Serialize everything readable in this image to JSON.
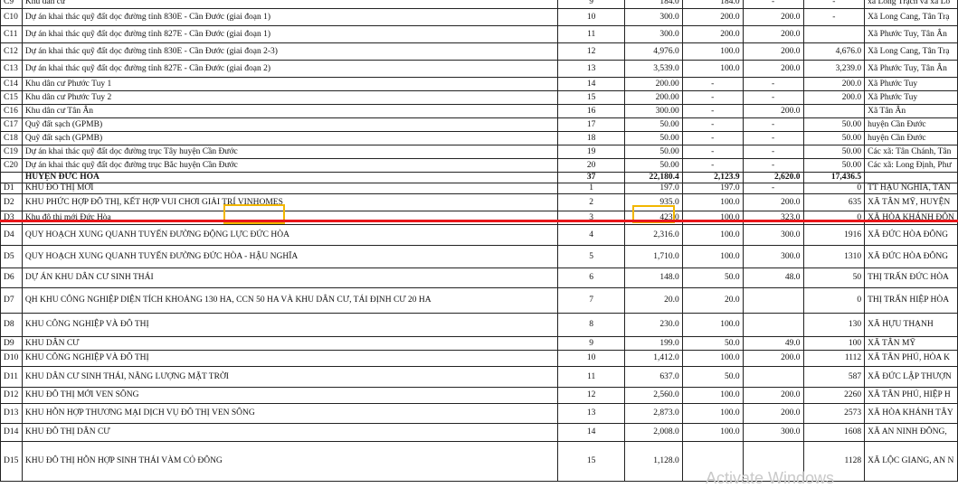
{
  "rows": [
    {
      "code": "C9",
      "name": "Khu dân cư",
      "stt": "9",
      "total": "184.0",
      "c1": "184.0",
      "c2": "-",
      "c3": "-",
      "loc": "xã Long Trạch và xã Lo",
      "h": 15
    },
    {
      "code": "C10",
      "name": "Dự án khai thác quỹ đất dọc đường tỉnh 830E - Cần Đước (giai đoạn 1)",
      "stt": "10",
      "total": "300.0",
      "c1": "200.0",
      "c2": "200.0",
      "c3": "-",
      "loc": "Xã Long Cang, Tân Trạ",
      "h": 19
    },
    {
      "code": "C11",
      "name": "Dự án khai thác quỹ đất dọc đường tỉnh 827E - Cần Đước (giai đoạn 1)",
      "stt": "11",
      "total": "300.0",
      "c1": "200.0",
      "c2": "200.0",
      "c3": "",
      "loc": "Xã Phước Tuy, Tân Ân",
      "h": 19
    },
    {
      "code": "C12",
      "name": "Dự án khai thác quỹ đất dọc đường tỉnh 830E - Cần Đước (giai đoạn 2-3)",
      "stt": "12",
      "total": "4,976.0",
      "c1": "100.0",
      "c2": "200.0",
      "c3": "4,676.0",
      "loc": "Xã Long Cang, Tân Trạ",
      "h": 19
    },
    {
      "code": "C13",
      "name": "Dự án khai thác quỹ đất dọc đường tỉnh 827E - Cần Đước (giai đoạn 2)",
      "stt": "13",
      "total": "3,539.0",
      "c1": "100.0",
      "c2": "200.0",
      "c3": "3,239.0",
      "loc": "Xã Phước Tuy, Tân Ân",
      "h": 19
    },
    {
      "code": "C14",
      "name": "Khu dân cư Phước Tuy 1",
      "stt": "14",
      "total": "200.00",
      "c1": "-",
      "c2": "-",
      "c3": "200.0",
      "loc": "Xã Phước Tuy",
      "h": 15
    },
    {
      "code": "C15",
      "name": "Khu dân cư Phước Tuy 2",
      "stt": "15",
      "total": "200.00",
      "c1": "-",
      "c2": "-",
      "c3": "200.0",
      "loc": "Xã Phước Tuy",
      "h": 15
    },
    {
      "code": "C16",
      "name": "Khu dân cư Tân Ân",
      "stt": "16",
      "total": "300.00",
      "c1": "-",
      "c2": "200.0",
      "c3": "",
      "loc": "Xã Tân Ân",
      "h": 15
    },
    {
      "code": "C17",
      "name": "Quỹ đất sạch (GPMB)",
      "stt": "17",
      "total": "50.00",
      "c1": "-",
      "c2": "-",
      "c3": "50.00",
      "loc": "huyện Cần Đước",
      "h": 15
    },
    {
      "code": "C18",
      "name": "Quỹ đất sạch (GPMB)",
      "stt": "18",
      "total": "50.00",
      "c1": "-",
      "c2": "-",
      "c3": "50.00",
      "loc": "huyện Cần Đước",
      "h": 15
    },
    {
      "code": "C19",
      "name": "Dự án khai thác quỹ đất dọc đường trục Tây huyện Cần Đước",
      "stt": "19",
      "total": "50.00",
      "c1": "-",
      "c2": "-",
      "c3": "50.00",
      "loc": "Các xã: Tân Chánh, Tân",
      "h": 15
    },
    {
      "code": "C20",
      "name": "Dự án khai thác quỹ đất dọc đường trục Bắc huyện Cần Đước",
      "stt": "20",
      "total": "50.00",
      "c1": "-",
      "c2": "-",
      "c3": "50.00",
      "loc": "Các xã: Long Định, Phư",
      "h": 15
    },
    {
      "code": "",
      "name": "HUYỆN ĐỨC HÒA",
      "stt": "37",
      "total": "22,180.4",
      "c1": "2,123.9",
      "c2": "2,620.0",
      "c3": "17,436.5",
      "loc": "",
      "h": 10,
      "group": true
    },
    {
      "code": "D1",
      "name": "KHU ĐÔ THỊ MỚI",
      "stt": "1",
      "total": "197.0",
      "c1": "197.0",
      "c2": "-",
      "c3": "0",
      "loc": "TT HẬU NGHĨA, TÂN",
      "h": 10
    },
    {
      "code": "D2",
      "name": "KHU PHỨC HỢP ĐÔ THỊ, KẾT HỢP VUI CHƠI GIẢI TRÍ VINHOMES",
      "stt": "2",
      "total": "935.0",
      "c1": "100.0",
      "c2": "200.0",
      "c3": "635",
      "loc": "XÃ TÂN MỸ, HUYỆN",
      "h": 19
    },
    {
      "code": "D3",
      "name": "Khu đô thị mới Đức Hòa",
      "stt": "3",
      "total": "423.0",
      "c1": "100.0",
      "c2": "323.0",
      "c3": "0",
      "loc": "XÃ HÒA KHÁNH ĐÔN",
      "h": 15
    },
    {
      "code": "D4",
      "name": "QUY HOẠCH XUNG QUANH TUYẾN ĐƯỜNG ĐỘNG LỰC ĐỨC HÒA",
      "stt": "4",
      "total": "2,316.0",
      "c1": "100.0",
      "c2": "300.0",
      "c3": "1916",
      "loc": "XÃ ĐỨC HÒA ĐÔNG",
      "h": 23
    },
    {
      "code": "D5",
      "name": "QUY HOẠCH XUNG QUANH TUYẾN ĐƯỜNG ĐỨC HÒA - HẬU NGHĨA",
      "stt": "5",
      "total": "1,710.0",
      "c1": "100.0",
      "c2": "300.0",
      "c3": "1310",
      "loc": "XÃ ĐỨC HÒA ĐÔNG",
      "h": 25
    },
    {
      "code": "D6",
      "name": "DỰ ÁN KHU DÂN CƯ SINH THÁI",
      "stt": "6",
      "total": "148.0",
      "c1": "50.0",
      "c2": "48.0",
      "c3": "50",
      "loc": "THỊ TRẤN ĐỨC HÒA",
      "h": 22
    },
    {
      "code": "D7",
      "name": "QH KHU CÔNG NGHIỆP DIỆN TÍCH KHOẢNG 130 HA, CCN 50 HA VÀ KHU DÂN CƯ, TÁI ĐỊNH CƯ 20 HA",
      "stt": "7",
      "total": "20.0",
      "c1": "20.0",
      "c2": "",
      "c3": "0",
      "loc": "THỊ TRẤN HIỆP HÒA",
      "h": 28
    },
    {
      "code": "D8",
      "name": "KHU CÔNG NGHIỆP VÀ ĐÔ THỊ",
      "stt": "8",
      "total": "230.0",
      "c1": "100.0",
      "c2": "",
      "c3": "130",
      "loc": "XÃ HỰU THẠNH",
      "h": 26
    },
    {
      "code": "D9",
      "name": "KHU DÂN CƯ",
      "stt": "9",
      "total": "199.0",
      "c1": "50.0",
      "c2": "49.0",
      "c3": "100",
      "loc": "XÃ TÂN MỸ",
      "h": 15
    },
    {
      "code": "D10",
      "name": "KHU CÔNG NGHIỆP VÀ ĐÔ THỊ",
      "stt": "10",
      "total": "1,412.0",
      "c1": "100.0",
      "c2": "200.0",
      "c3": "1112",
      "loc": "XÃ TÂN PHÚ, HÒA K",
      "h": 18
    },
    {
      "code": "D11",
      "name": "KHU DÂN CƯ SINH THÁI, NĂNG LƯỢNG MẶT TRỜI",
      "stt": "11",
      "total": "637.0",
      "c1": "50.0",
      "c2": "",
      "c3": "587",
      "loc": "XÃ ĐỨC LẬP THƯỢN",
      "h": 23
    },
    {
      "code": "D12",
      "name": "KHU ĐÔ THỊ MỚI VEN SÔNG",
      "stt": "12",
      "total": "2,560.0",
      "c1": "100.0",
      "c2": "200.0",
      "c3": "2260",
      "loc": "XÃ TÂN PHÚ, HIỆP H",
      "h": 18
    },
    {
      "code": "D13",
      "name": "KHU HỖN HỢP THƯƠNG MẠI DỊCH VỤ ĐÔ THỊ VEN SÔNG",
      "stt": "13",
      "total": "2,873.0",
      "c1": "100.0",
      "c2": "200.0",
      "c3": "2573",
      "loc": "XÃ HÒA KHÁNH TÂY",
      "h": 22
    },
    {
      "code": "D14",
      "name": "KHU ĐÔ THỊ DÂN CƯ",
      "stt": "14",
      "total": "2,008.0",
      "c1": "100.0",
      "c2": "300.0",
      "c3": "1608",
      "loc": "XÃ AN NINH ĐÔNG,",
      "h": 20
    },
    {
      "code": "D15",
      "name": "KHU ĐÔ THỊ HỖN HỢP SINH THÁI VÀM CỎ ĐÔNG",
      "stt": "15",
      "total": "1,128.0",
      "c1": "",
      "c2": "",
      "c3": "1128",
      "loc": "XÃ LỘC GIANG, AN N",
      "h": 44
    }
  ],
  "watermark": "Activate Windows",
  "colors": {
    "highlight": "#f2b600",
    "rule": "#e8161a"
  }
}
